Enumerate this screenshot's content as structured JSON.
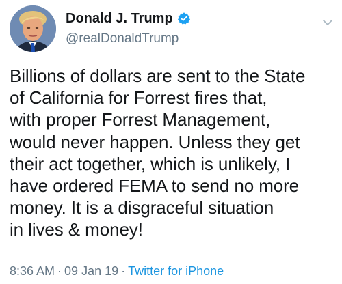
{
  "user": {
    "display_name": "Donald J. Trump",
    "handle": "@realDonaldTrump",
    "verified": true,
    "avatar_icon": "profile-photo-icon"
  },
  "tweet": {
    "text": "Billions of dollars are sent to the State\nof California for Forrest fires that,\nwith proper Forrest Management,\nwould never happen. Unless they get\ntheir act together, which is unlikely, I\nhave ordered FEMA to send no more\nmoney. It is a disgraceful situation\nin lives & money!",
    "time": "8:36 AM",
    "separator": "·",
    "date": "09 Jan 19",
    "source": "Twitter for iPhone"
  },
  "colors": {
    "text": "#14171a",
    "secondary": "#657786",
    "link": "#1b95e0",
    "verified": "#1da1f2"
  },
  "icons": {
    "verified": "verified-badge-icon",
    "menu": "chevron-down-icon"
  }
}
